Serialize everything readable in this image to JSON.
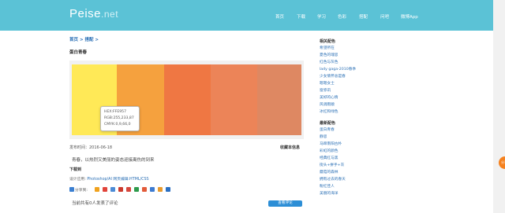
{
  "header": {
    "logo_main": "Peise",
    "logo_ext": ".net",
    "nav": [
      "首页",
      "下载",
      "学习",
      "色彩",
      "搭配",
      "问吧",
      "微博App"
    ]
  },
  "breadcrumb": {
    "home": "首页",
    "sep1": ">",
    "section": "搭配",
    "sep2": ">"
  },
  "page_title": "蛋白青春",
  "palette": {
    "colors": [
      "#FFE957",
      "#F5A13E",
      "#EF7743",
      "#EC8458",
      "#DE8862"
    ],
    "tooltip": {
      "hex": "HEX:FFE957",
      "rgb": "RGB:255,233,87",
      "cmyk": "CMYK:0,9,66,0"
    }
  },
  "meta": {
    "published": "发布时间：2016-06-18",
    "collect": "收藏本信息"
  },
  "description": "青春，以热烈又美丽的姿态迎接离伤的到来",
  "download": {
    "heading": "下载到",
    "design_prefix": "设计应用:",
    "design_links": "Photoshop/AI 网页编辑:HTML/CSS"
  },
  "share": {
    "label": "分享到:"
  },
  "comments": {
    "count_text": "当前共有0人发表了评论",
    "button": "查看评论"
  },
  "sidebar": {
    "popular_heading": "相关配色",
    "popular": [
      "希望所在",
      "夏色的魂思",
      "红色与灰色",
      "lady gaga-2010春季",
      "少女情怀总是春",
      "嗯嗯女士",
      "窗弥讯",
      "美好的心情",
      "风调雨顺",
      "冰红和绿色"
    ],
    "latest_heading": "最新配色",
    "latest": [
      "蛋白青春",
      "静思",
      "马蹄南阳古朴",
      "彩虹的颜色",
      "经典红与黑",
      "街头+拼手+灰",
      "蘑菇的森林",
      "拥有过去的春天",
      "粉红佳人",
      "美丽的海洋"
    ]
  },
  "float_button": "分享"
}
